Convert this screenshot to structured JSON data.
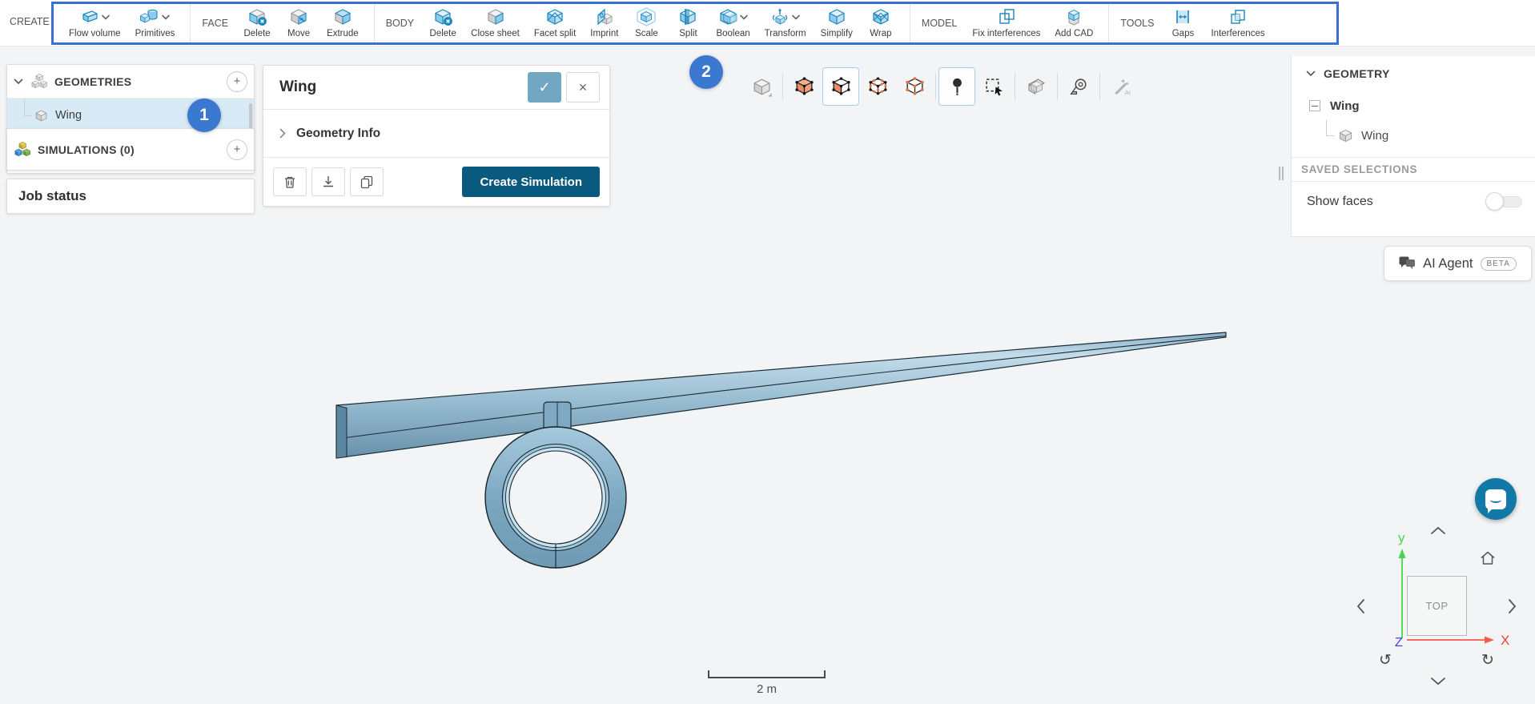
{
  "toolbar": {
    "create_label": "CREATE",
    "flow_volume": "Flow volume",
    "primitives": "Primitives",
    "face_label": "FACE",
    "face_delete": "Delete",
    "face_move": "Move",
    "face_extrude": "Extrude",
    "body_label": "BODY",
    "body_delete": "Delete",
    "body_close_sheet": "Close sheet",
    "body_facet_split": "Facet split",
    "body_imprint": "Imprint",
    "body_scale": "Scale",
    "body_split": "Split",
    "body_boolean": "Boolean",
    "body_transform": "Transform",
    "body_simplify": "Simplify",
    "body_wrap": "Wrap",
    "model_label": "MODEL",
    "model_fix_interferences": "Fix interferences",
    "model_add_cad": "Add CAD",
    "tools_label": "TOOLS",
    "tools_gaps": "Gaps",
    "tools_interferences": "Interferences"
  },
  "annotations": {
    "step1": "1",
    "step2": "2"
  },
  "left_panel": {
    "geometries_label": "GEOMETRIES",
    "wing_label": "Wing",
    "simulations_label": "SIMULATIONS (0)",
    "job_status_label": "Job status"
  },
  "dialog": {
    "title": "Wing",
    "confirm_glyph": "✓",
    "cancel_glyph": "×",
    "geometry_info_label": "Geometry Info",
    "create_simulation_label": "Create Simulation"
  },
  "selection_bar": {
    "ai_label": "AI"
  },
  "right_panel": {
    "geometry_label": "GEOMETRY",
    "wing_parent_label": "Wing",
    "wing_child_label": "Wing",
    "saved_selections_label": "SAVED SELECTIONS",
    "show_faces_label": "Show faces"
  },
  "ai_agent": {
    "label": "AI Agent",
    "badge": "BETA"
  },
  "viewport": {
    "scale_label": "2 m",
    "view_cube_face": "TOP",
    "axis_x": "X",
    "axis_y": "y",
    "axis_z": "Z",
    "rotate_ccw_glyph": "↺",
    "rotate_cw_glyph": "↻"
  },
  "colors": {
    "annotation_border": "#3a70d6",
    "badge_blue": "#3b78d0",
    "icon_blue": "#1d86bd",
    "primary_button": "#0a5a7f",
    "confirm_button": "#72a7c3",
    "selection_highlight": "#d8eaf6",
    "axis_x": "#e8463c",
    "axis_y": "#4ad44e",
    "axis_z": "#4343e0",
    "selection_orange": "#e8875a"
  }
}
